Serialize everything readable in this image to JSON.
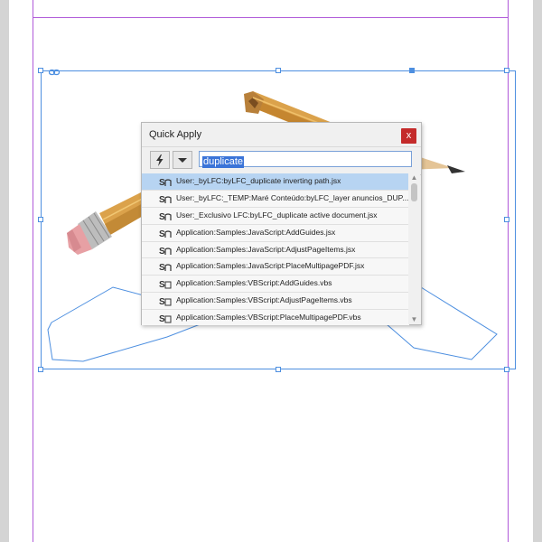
{
  "panel": {
    "title": "Quick Apply",
    "close_glyph": "x",
    "search_value": "duplicate",
    "tools": [
      {
        "icon": "lightning-icon"
      },
      {
        "icon": "dropdown-arrow-icon"
      }
    ],
    "items": [
      {
        "label": "User:_byLFC:byLFC_duplicate inverting path.jsx",
        "icon": "script-icon",
        "selected": true
      },
      {
        "label": "User:_byLFC:_TEMP:Maré Conteúdo:byLFC_layer anuncios_DUP...",
        "icon": "script-icon",
        "selected": false
      },
      {
        "label": "User:_Exclusivo LFC:byLFC_duplicate active document.jsx",
        "icon": "script-icon",
        "selected": false
      },
      {
        "label": "Application:Samples:JavaScript:AddGuides.jsx",
        "icon": "script-icon",
        "selected": false
      },
      {
        "label": "Application:Samples:JavaScript:AdjustPageItems.jsx",
        "icon": "script-icon",
        "selected": false
      },
      {
        "label": "Application:Samples:JavaScript:PlaceMultipagePDF.jsx",
        "icon": "script-icon",
        "selected": false
      },
      {
        "label": "Application:Samples:VBScript:AddGuides.vbs",
        "icon": "vbscript-icon",
        "selected": false
      },
      {
        "label": "Application:Samples:VBScript:AdjustPageItems.vbs",
        "icon": "vbscript-icon",
        "selected": false
      },
      {
        "label": "Application:Samples:VBScript:PlaceMultipagePDF.vbs",
        "icon": "vbscript-icon",
        "selected": false
      }
    ]
  },
  "colors": {
    "selection_blue": "#4d8fe0",
    "margin_guide": "#b05ad9",
    "close_red": "#c42b2b",
    "row_selected": "#b7d4f2"
  }
}
